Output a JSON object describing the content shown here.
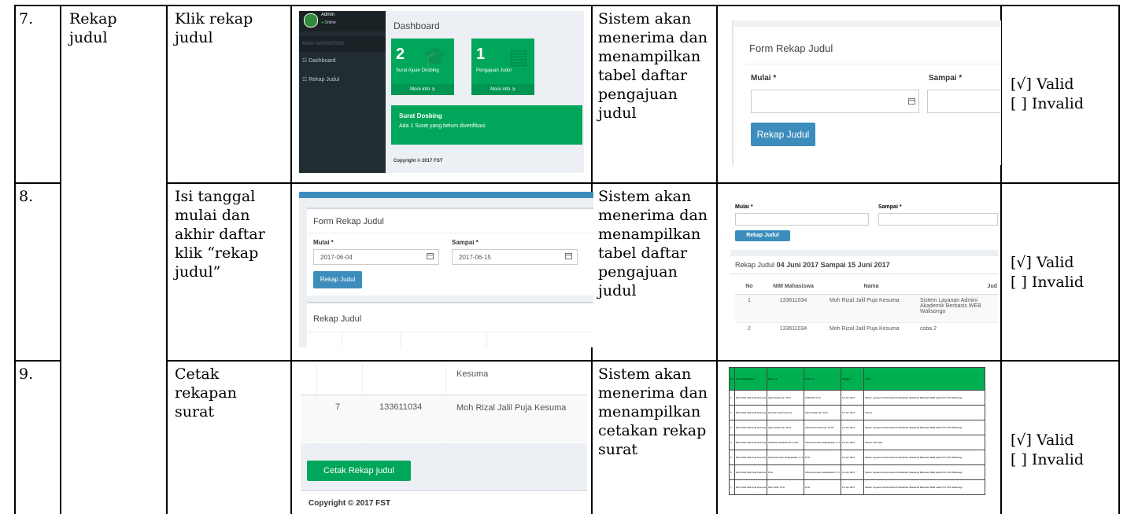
{
  "rows": [
    {
      "no": "7.",
      "feature": "Rekap judul",
      "action": "Klik rekap judul",
      "expected": "Sistem akan menerima dan menampilkan tabel daftar pengajuan judul",
      "valid": "[√] Valid",
      "invalid": "[   ] Invalid"
    },
    {
      "no": "8.",
      "feature": "",
      "action": "Isi tanggal mulai dan akhir daftar klik “rekap judul”",
      "expected": "Sistem akan menerima dan menampilkan tabel daftar pengajuan judul",
      "valid": "[√] Valid",
      "invalid": "[   ] Invalid"
    },
    {
      "no": "9.",
      "feature": "",
      "action": "Cetak rekapan surat",
      "expected": "Sistem akan menerima dan menampilkan cetakan rekap surat",
      "valid": "[√] Valid",
      "invalid": "[   ] Invalid"
    }
  ],
  "dashboard": {
    "title": "Dashboard",
    "user_name": "Admin",
    "user_status": "Online",
    "menu_header": "MAIN NAVIGATION",
    "menu_items": [
      "Dashboard",
      "Rekap Judul"
    ],
    "tile1": {
      "count": "2",
      "label": "Surat Ajuan Dosbing",
      "more": "More info"
    },
    "tile2": {
      "count": "1",
      "label": "Pengajuan Judul",
      "more": "More info"
    },
    "alert_title": "Surat Dosbing",
    "alert_text": "Ada 1 Surat yang belum diverifikasi",
    "copyright": "Copyright © 2017 FST"
  },
  "form_empty": {
    "title": "Form Rekap Judul",
    "mulai_label": "Mulai *",
    "sampai_label": "Sampai *",
    "button": "Rekap Judul"
  },
  "form_filled": {
    "title": "Form Rekap Judul",
    "mulai_label": "Mulai *",
    "sampai_label": "Sampai *",
    "mulai_value": "2017-06-04",
    "sampai_value": "2017-06-15",
    "button": "Rekap Judul",
    "section_title": "Rekap Judul"
  },
  "rekap_result": {
    "mulai_label": "Mulai *",
    "sampai_label": "Sampai *",
    "button": "Rekap Judul",
    "heading_prefix": "Rekap Judul",
    "heading_range": "04 Juni 2017 Sampai 15 Juni 2017",
    "columns": [
      "No",
      "NIM Mahasiswa",
      "Nama",
      "Jud"
    ],
    "rows": [
      {
        "no": "1",
        "nim": "133611034",
        "nama": "Moh Rizal Jalil Puja Kesuma",
        "judul": "Sistem Layanan Admini Akademik Berbasis WEB Walisongo"
      },
      {
        "no": "2",
        "nim": "133611034",
        "nama": "Moh Rizal Jalil Puja Kesuma",
        "judul": "coba 2"
      }
    ]
  },
  "print_shot": {
    "prev_name": "Kesuma",
    "row_no": "7",
    "row_nim": "133611034",
    "row_name": "Moh Rizal Jalil Puja Kesuma",
    "button": "Cetak Rekap judul",
    "copyright": "Copyright © 2017 FST"
  },
  "print_table": {
    "headers": [
      "No",
      "Nama Mahasiswa",
      "Dosen 1",
      "Dosen 2",
      "Tanggal",
      "Judul"
    ],
    "rows": [
      [
        "1",
        "Moh Rizal Jalil Puja Kesuma",
        "Agus Sulaeman, M.Si",
        "AFRIANI, M.Si",
        "13 Jun 2017",
        "Sistem Layanan Administrasi Perkuliahan Akademik Berbasis WEB pada FST UIN Walisongo"
      ],
      [
        "2",
        "Moh Rizal Jalil Puja Kesuma",
        "Hamdan Hadi Kusuma",
        "Agus Sulaeman, M.Si",
        "13 Jun 2017",
        "coba 2"
      ],
      [
        "3",
        "Moh Rizal Jalil Puja Kesuma",
        "Agus Sulaeman, M.Si",
        "Ahmad Abu Rohman, M.Pd",
        "13 Jun 2017",
        "Sistem Layanan Administrasi Perkuliahan Akademik Berbasis WEB pada FST UIN Walisongo"
      ],
      [
        "4",
        "Moh Rizal Jalil Puja Kesuma",
        "ALWIYAH NURHAYATI, M.Si",
        "Ahmad Fauzan Hidayatullah, S.T., M.Eng",
        "13 Jun 2017",
        "Sistem Informasi"
      ],
      [
        "5",
        "Moh Rizal Jalil Puja Kesuma",
        "Ahmad Fauzan Hidayatullah, S.T., M.Eng",
        "M.Si",
        "13 Jun 2017",
        "Sistem Layanan Administrasi Perkuliahan Akademik Berbasis WEB pada FST UIN Walisongo"
      ],
      [
        "6",
        "Moh Rizal Jalil Puja Kesuma",
        "M.Si",
        "Ahmad Fauzan Hidayatullah, S.T., M.Eng",
        "13 Jun 2017",
        "Sistem Layanan Administrasi Perkuliahan Akademik Berbasis WEB pada FST UIN Walisongo"
      ],
      [
        "7",
        "Moh Rizal Jalil Puja Kesuma",
        "Moh Rizal, M.Si",
        "M.Si",
        "13 Jun 2017",
        "Sistem Layanan Administrasi Perkuliahan Akademik Berbasis WEB pada FST UIN Walisongo"
      ]
    ]
  }
}
